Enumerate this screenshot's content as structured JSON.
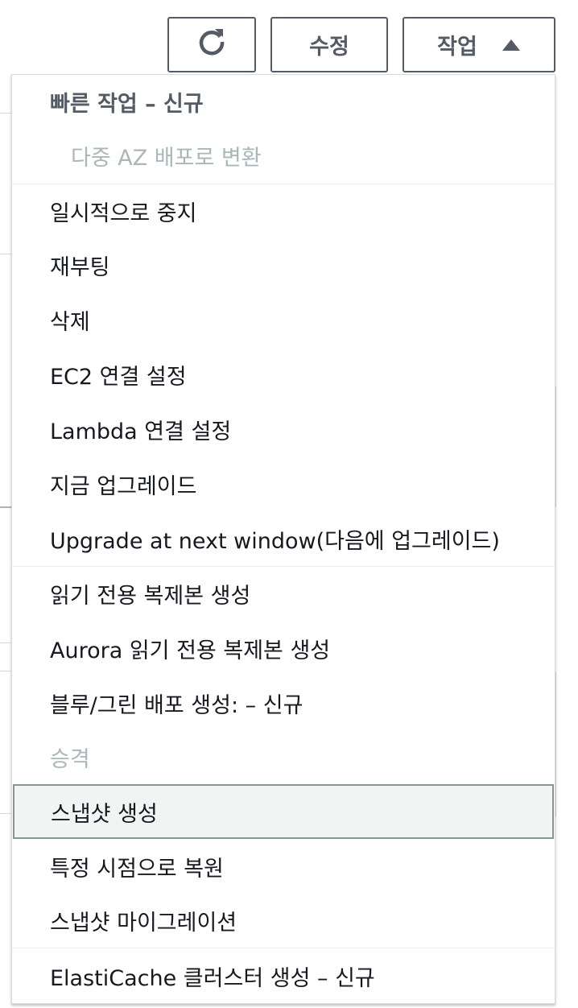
{
  "toolbar": {
    "refresh_icon": "refresh-icon",
    "edit_label": "수정",
    "actions_label": "작업",
    "actions_caret_icon": "caret-up-icon"
  },
  "menu": {
    "items": [
      {
        "label": "빠른 작업 – 신규",
        "kind": "header"
      },
      {
        "label": "다중 AZ 배포로 변환",
        "kind": "disabled-sub"
      },
      {
        "label": "일시적으로 중지",
        "kind": "item"
      },
      {
        "label": "재부팅",
        "kind": "item"
      },
      {
        "label": "삭제",
        "kind": "item"
      },
      {
        "label": "EC2 연결 설정",
        "kind": "item"
      },
      {
        "label": "Lambda 연결 설정",
        "kind": "item"
      },
      {
        "label": "지금 업그레이드",
        "kind": "item"
      },
      {
        "label": "Upgrade at next window(다음에 업그레이드)",
        "kind": "item"
      },
      {
        "label": "읽기 전용 복제본 생성",
        "kind": "item"
      },
      {
        "label": "Aurora 읽기 전용 복제본 생성",
        "kind": "item"
      },
      {
        "label": "블루/그린 배포 생성: – 신규",
        "kind": "item"
      },
      {
        "label": "승격",
        "kind": "disabled"
      },
      {
        "label": "스냅샷 생성",
        "kind": "highlighted"
      },
      {
        "label": "특정 시점으로 복원",
        "kind": "item"
      },
      {
        "label": "스냅샷 마이그레이션",
        "kind": "item"
      },
      {
        "label": "ElastiCache 클러스터 생성 – 신규",
        "kind": "item"
      }
    ]
  },
  "colors": {
    "button_border": "#545b64",
    "text": "#16191f",
    "disabled_text": "#aab7b8",
    "highlight_bg": "#f2f3f3",
    "highlight_border": "#879596"
  }
}
